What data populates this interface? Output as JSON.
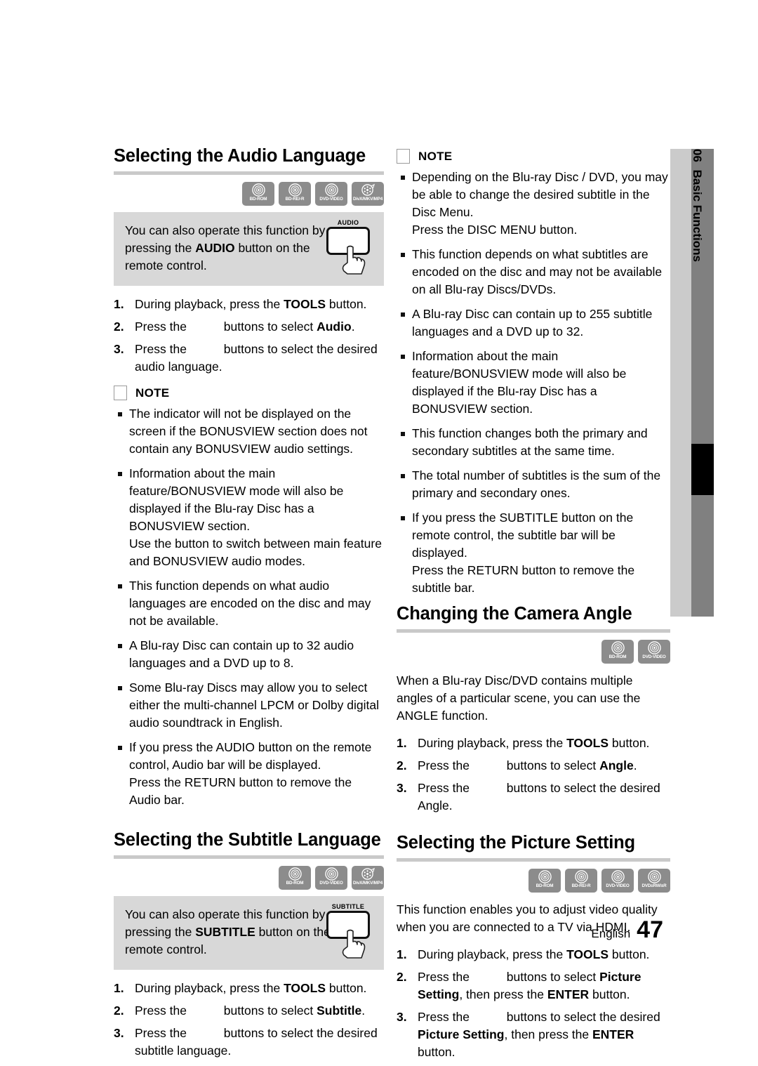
{
  "page": {
    "footer_language": "English",
    "footer_page_number": "47",
    "side_tab": {
      "chapter_number": "06",
      "chapter_title": "Basic Functions"
    }
  },
  "icons": {
    "note_square": "note-square-icon",
    "disc_bd_rom": "bd-rom-disc-icon",
    "disc_bd_re_r": "bd-re-r-disc-icon",
    "disc_dvd_video": "dvd-video-disc-icon",
    "disc_divx": "divx-mkv-mp4-disc-icon",
    "disc_dvd_rw_r": "dvd-rw-r-disc-icon",
    "hand_pointer": "hand-pointer-icon"
  },
  "sections": {
    "audio_language": {
      "heading": "Selecting the Audio Language",
      "badges": [
        "BD-ROM",
        "BD-RE/-R",
        "DVD-VIDEO",
        "DivX/MKV/MP4"
      ],
      "tip": {
        "text_a": "You can also operate this function by pressing the ",
        "text_b": "AUDIO",
        "text_c": " button on the remote control.",
        "remote_button_label": "AUDIO"
      },
      "steps": [
        {
          "num": "1.",
          "a": "During playback, press the ",
          "b": "TOOLS",
          "c": " button."
        },
        {
          "num": "2.",
          "a": "Press the ",
          "b": "",
          "c": "buttons to select ",
          "d": "Audio",
          "e": "."
        },
        {
          "num": "3.",
          "a": "Press the ",
          "b": "",
          "c": "buttons to select the desired audio language."
        }
      ],
      "note_title": "NOTE",
      "notes": [
        "The    indicator will not be displayed on the screen if the BONUSVIEW section does not contain any BONUSVIEW audio settings.",
        "Information about the main feature/BONUSVIEW mode will also be displayed if the Blu-ray Disc has a BONUSVIEW section.",
        "Use the    button to switch between main feature and BONUSVIEW audio modes.",
        "This function depends on what audio languages are encoded on the disc and may not be available.",
        "A Blu-ray Disc can contain up to 32 audio languages and a DVD up to 8.",
        "Some Blu-ray Discs may allow you to select either the multi-channel LPCM or Dolby digital audio soundtrack in English.",
        "If you press the AUDIO button on the remote control, Audio bar will be displayed.",
        "Press the RETURN button to remove the Audio bar."
      ]
    },
    "subtitle_language": {
      "heading": "Selecting the Subtitle Language",
      "badges": [
        "BD-ROM",
        "DVD-VIDEO",
        "DivX/MKV/MP4"
      ],
      "tip": {
        "text_a": "You can also operate this function by pressing the ",
        "text_b": "SUBTITLE",
        "text_c": " button on the remote control.",
        "remote_button_label": "SUBTITLE"
      },
      "steps": [
        {
          "num": "1.",
          "a": "During playback, press the ",
          "b": "TOOLS",
          "c": " button."
        },
        {
          "num": "2.",
          "a": "Press the ",
          "b": "",
          "c": "buttons to select ",
          "d": "Subtitle",
          "e": "."
        },
        {
          "num": "3.",
          "a": "Press the ",
          "b": "",
          "c": "buttons to select the desired subtitle language."
        }
      ],
      "note_title": "NOTE",
      "notes": [
        "Depending on the Blu-ray Disc / DVD, you may be able to change the desired subtitle in the Disc Menu.",
        "Press the DISC MENU button.",
        "This function depends on what subtitles are encoded on the disc and may not be available on all Blu-ray Discs/DVDs.",
        "A Blu-ray Disc can contain up to 255 subtitle languages and a DVD up to 32.",
        "Information about the main feature/BONUSVIEW mode will also be displayed if the Blu-ray Disc has a BONUSVIEW section.",
        "This function changes both the primary and secondary subtitles at the same time.",
        "The total number of subtitles is the sum of the primary and secondary ones.",
        "If you press the SUBTITLE button on the remote control, the subtitle bar will be displayed.",
        "Press the RETURN button to remove the subtitle bar."
      ]
    },
    "camera_angle": {
      "heading": "Changing the Camera Angle",
      "badges": [
        "BD-ROM",
        "DVD-VIDEO"
      ],
      "intro": "When a Blu-ray Disc/DVD contains multiple angles of a particular scene, you can use the ANGLE function.",
      "steps": [
        {
          "num": "1.",
          "a": "During playback, press the ",
          "b": "TOOLS",
          "c": " button."
        },
        {
          "num": "2.",
          "a": "Press the ",
          "b": "",
          "c": "buttons to select ",
          "d": "Angle",
          "e": "."
        },
        {
          "num": "3.",
          "a": "Press the ",
          "b": "",
          "c": "buttons to select the desired Angle."
        }
      ]
    },
    "picture_setting": {
      "heading": "Selecting the Picture Setting",
      "badges": [
        "BD-ROM",
        "BD-RE/-R",
        "DVD-VIDEO",
        "DVD±RW/±R"
      ],
      "intro": "This function enables you to adjust video quality when you are connected to a TV via HDMI.",
      "steps": [
        {
          "num": "1.",
          "a": "During playback, press the ",
          "b": "TOOLS",
          "c": " button."
        },
        {
          "num": "2.",
          "a": "Press the ",
          "b": "",
          "c": "buttons to select ",
          "d": "Picture Setting",
          "e": ", then press the ",
          "f": "ENTER",
          "g": " button."
        },
        {
          "num": "3.",
          "a": "Press the ",
          "b": "",
          "c": "buttons to select the desired ",
          "d": "Picture Setting",
          "e": ", then press the ",
          "f": "ENTER",
          "g": " button."
        }
      ]
    }
  }
}
